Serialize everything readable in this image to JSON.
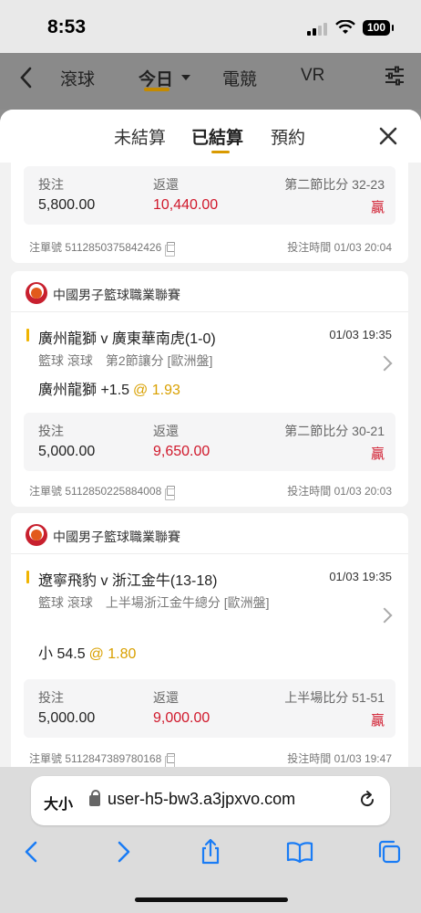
{
  "status_bar": {
    "time": "8:53",
    "battery": "100"
  },
  "top_nav": {
    "tabs": [
      "滾球",
      "今日",
      "電競",
      "VR"
    ]
  },
  "sheet": {
    "tabs": [
      "未結算",
      "已結算",
      "預約"
    ],
    "active_tab": "已結算"
  },
  "labels": {
    "stake": "投注",
    "return": "返還",
    "ticket_prefix": "注單號",
    "bet_time_prefix": "投注時間"
  },
  "bets": [
    {
      "stake": "5,800.00",
      "return": "10,440.00",
      "score": "第二節比分 32-23",
      "result": "贏",
      "ticket": "5112850375842426",
      "bet_time": "01/03 20:04"
    },
    {
      "league": "中國男子籃球職業聯賽",
      "match": "廣州龍獅 v 廣東華南虎(1-0)",
      "match_time": "01/03 19:35",
      "desc": "籃球 滾球　第2節讓分 [歐洲盤]",
      "pick": "廣州龍獅 +1.5",
      "odds": "@ 1.93",
      "stake": "5,000.00",
      "return": "9,650.00",
      "score": "第二節比分 30-21",
      "result": "贏",
      "ticket": "5112850225884008",
      "bet_time": "01/03 20:03"
    },
    {
      "league": "中國男子籃球職業聯賽",
      "match": "遼寧飛豹 v 浙江金牛(13-18)",
      "match_time": "01/03 19:35",
      "desc": "籃球 滾球　上半場浙江金牛總分 [歐洲盤]",
      "pick": "小 54.5",
      "odds": "@ 1.80",
      "stake": "5,000.00",
      "return": "9,000.00",
      "score": "上半場比分 51-51",
      "result": "贏",
      "ticket": "5112847389780168",
      "bet_time": "01/03 19:47"
    }
  ],
  "browser": {
    "text_size": "大小",
    "url": "user-h5-bw3.a3jpxvo.com"
  }
}
